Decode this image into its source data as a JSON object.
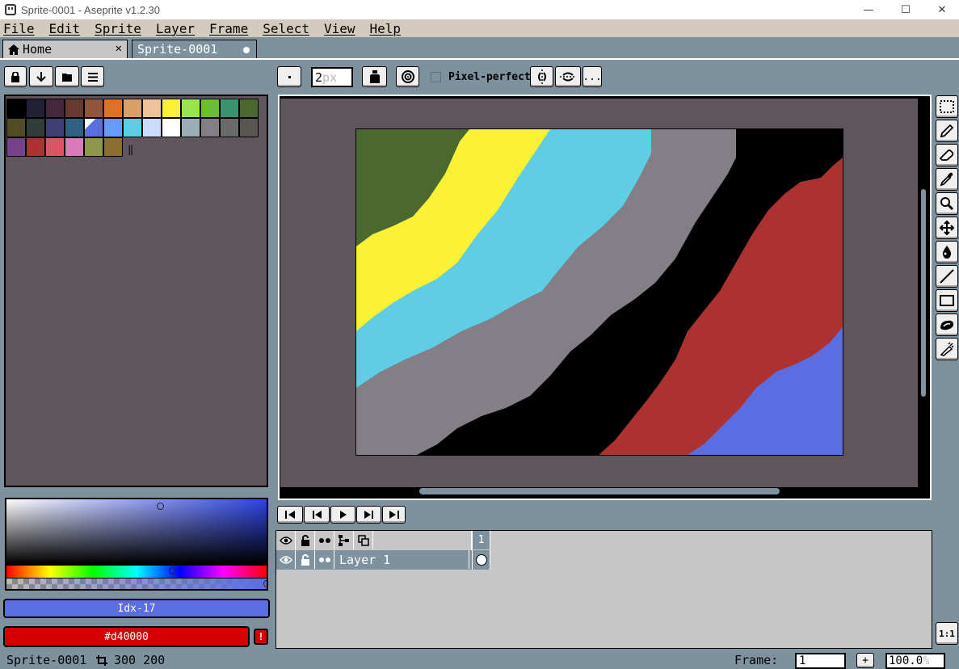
{
  "window": {
    "title": "Sprite-0001 - Aseprite v1.2.30",
    "minimize": "—",
    "maximize": "☐",
    "close": "✕"
  },
  "menu": [
    "File",
    "Edit",
    "Sprite",
    "Layer",
    "Frame",
    "Select",
    "View",
    "Help"
  ],
  "tabs": {
    "home": "Home",
    "home_icon": "house-icon",
    "home_close": "✕",
    "sprite": "Sprite-0001"
  },
  "context_bar": {
    "brush_size": "2",
    "brush_unit": "px",
    "pixel_perfect_label": "Pixel-perfect",
    "pixel_perfect_checked": false,
    "more_label": "..."
  },
  "palette": {
    "colors": [
      "#000000",
      "#222034",
      "#45283c",
      "#663931",
      "#8f563b",
      "#df7126",
      "#d9a066",
      "#eec39a",
      "#fbf236",
      "#99e550",
      "#6abe30",
      "#37946e",
      "#4b692f",
      "#524b24",
      "#323c39",
      "#3f3f74",
      "#306082",
      "#5b6ee1",
      "#639bff",
      "#5fcde4",
      "#cbdbfc",
      "#ffffff",
      "#9badb7",
      "#847e87",
      "#696a6a",
      "#595652",
      "#76428a",
      "#ac3232",
      "#d95763",
      "#d77bba",
      "#8f974a",
      "#8a6f30"
    ],
    "selected_index": 17
  },
  "color_picker": {
    "hue_color": "#2d44e1"
  },
  "fg_color": {
    "label": "Idx-17",
    "hex": "#5b6ee1"
  },
  "bg_color": {
    "label": "#d40000",
    "hex": "#d40000",
    "warning": "!"
  },
  "canvas": {
    "sprite_width": 300,
    "sprite_height": 200,
    "bands": [
      {
        "name": "dark-green",
        "color": "#4b692f"
      },
      {
        "name": "yellow",
        "color": "#fbf236"
      },
      {
        "name": "cyan",
        "color": "#5fcde4"
      },
      {
        "name": "gray",
        "color": "#847e87"
      },
      {
        "name": "black",
        "color": "#000000"
      },
      {
        "name": "red",
        "color": "#ac3232"
      },
      {
        "name": "blue",
        "color": "#5b6ee1"
      }
    ]
  },
  "tools": [
    "marquee-icon",
    "pencil-icon",
    "eraser-icon",
    "eyedropper-icon",
    "zoom-icon",
    "move-icon",
    "paint-bucket-icon",
    "line-icon",
    "rectangle-icon",
    "contour-icon",
    "blur-icon"
  ],
  "timeline": {
    "frame_header": "1",
    "layers": [
      {
        "name": "Layer 1",
        "visible": true,
        "locked": false
      }
    ]
  },
  "zoom_fit_label": "1:1",
  "status": {
    "sprite_name": "Sprite-0001",
    "size": "300 200",
    "frame_label": "Frame:",
    "frame_value": "1",
    "add_frame": "+",
    "zoom_value": "100.0",
    "zoom_unit": "%"
  }
}
